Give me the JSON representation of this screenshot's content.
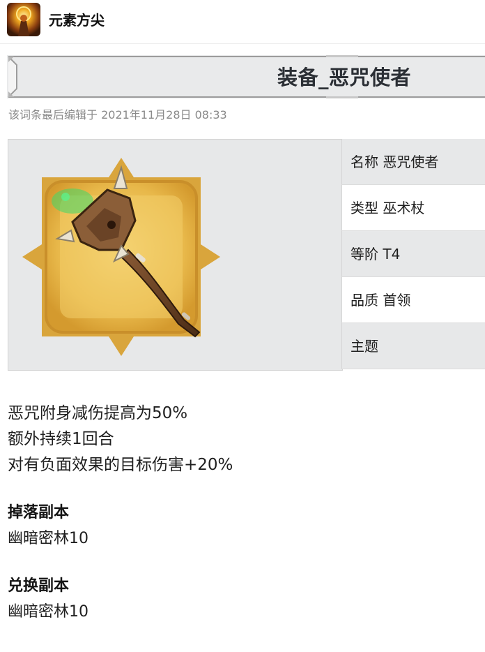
{
  "app": {
    "name": "元素方尖"
  },
  "page": {
    "title": "装备_恶咒使者",
    "edit_time": "该词条最后编辑于 2021年11月28日 08:33"
  },
  "infobox": {
    "rows": [
      {
        "text": "名称 恶咒使者"
      },
      {
        "text": "类型 巫术杖"
      },
      {
        "text": "等阶 T4"
      },
      {
        "text": "品质 首领"
      },
      {
        "text": "主题"
      }
    ],
    "item_icon": "staff-weapon-icon"
  },
  "description": {
    "lines": [
      "恶咒附身减伤提高为50%",
      "额外持续1回合",
      "对有负面效果的目标伤害+20%"
    ]
  },
  "sections": [
    {
      "title": "掉落副本",
      "value": "幽暗密林10"
    },
    {
      "title": "兑换副本",
      "value": "幽暗密林10"
    }
  ],
  "colors": {
    "frame_gold": "#d9a53c",
    "infobox_shade": "#e7e8e9"
  }
}
